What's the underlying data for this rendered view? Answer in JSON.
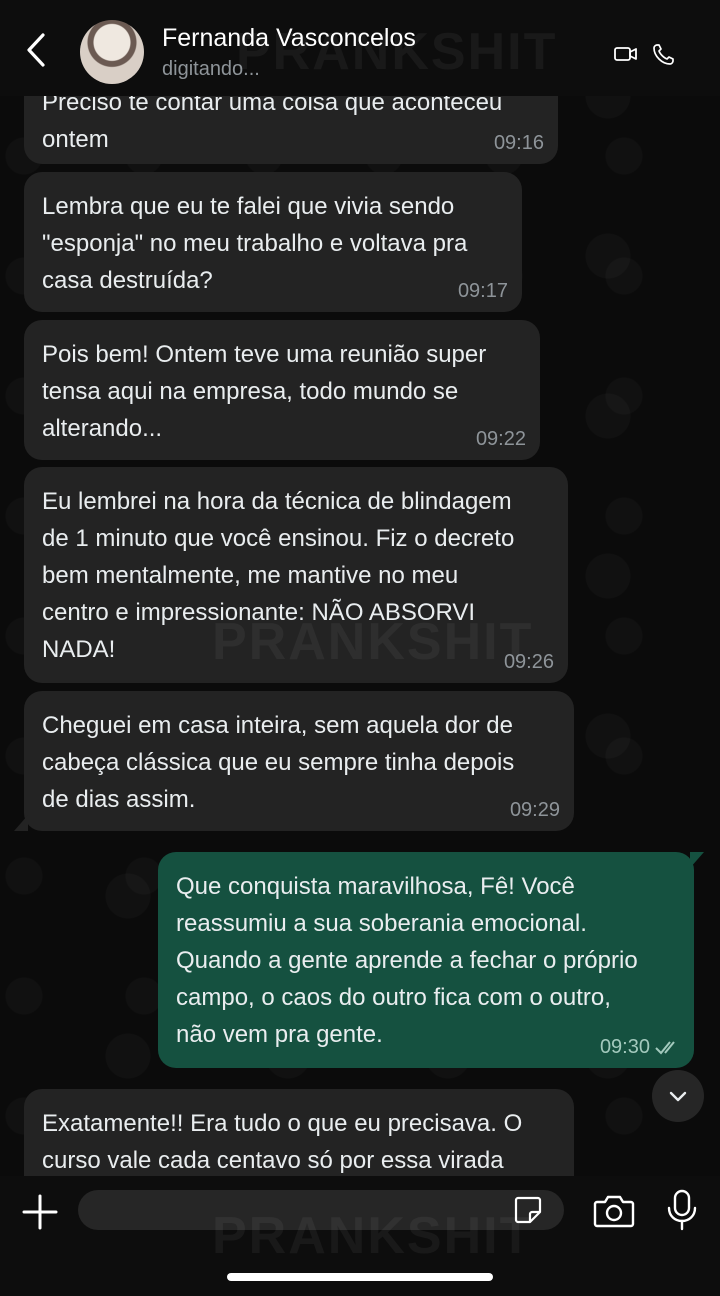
{
  "header": {
    "contact_name": "Fernanda Vasconcelos",
    "status": "digitando..."
  },
  "messages": [
    {
      "direction": "incoming",
      "text": "Preciso te contar uma coisa que aconteceu\nontem",
      "time": "09:16"
    },
    {
      "direction": "incoming",
      "text": "Lembra que eu te falei que vivia sendo\n\"esponja\" no meu trabalho e voltava pra\ncasa destruída?",
      "time": "09:17"
    },
    {
      "direction": "incoming",
      "text": "Pois bem! Ontem teve uma reunião super\ntensa aqui na empresa, todo mundo se\nalterando...",
      "time": "09:22"
    },
    {
      "direction": "incoming",
      "text": "Eu lembrei na hora da técnica de blindagem\nde 1 minuto que você ensinou. Fiz o decreto\nbem mentalmente, me mantive no meu\ncentro e impressionante: NÃO ABSORVI\nNADA!",
      "time": "09:26"
    },
    {
      "direction": "incoming",
      "text": "Cheguei em casa inteira, sem aquela dor de\ncabeça clássica que eu sempre tinha depois\nde dias assim.",
      "time": "09:29"
    },
    {
      "direction": "outgoing",
      "text": "Que conquista maravilhosa, Fê! Você\nreassumiu a sua soberania emocional.\nQuando a gente aprende a fechar o próprio\ncampo, o caos do outro fica com o outro,\nnão vem pra gente.",
      "time": "09:30",
      "status": "read"
    },
    {
      "direction": "incoming",
      "text": "Exatamente!! Era tudo o que eu precisava. O\ncurso vale cada centavo só por essa virada",
      "time": ""
    }
  ],
  "composer": {
    "placeholder": ""
  },
  "watermark": "PRANKSHIT",
  "colors": {
    "incoming_bubble": "#232323",
    "outgoing_bubble": "#155140",
    "background": "#0b0b0b"
  },
  "icons": {
    "back": "chevron-left-icon",
    "video": "video-camera-icon",
    "phone": "phone-icon",
    "scroll": "chevron-down-icon",
    "plus": "plus-icon",
    "sticker": "sticker-icon",
    "camera": "camera-icon",
    "mic": "microphone-icon",
    "read": "double-check-icon"
  }
}
